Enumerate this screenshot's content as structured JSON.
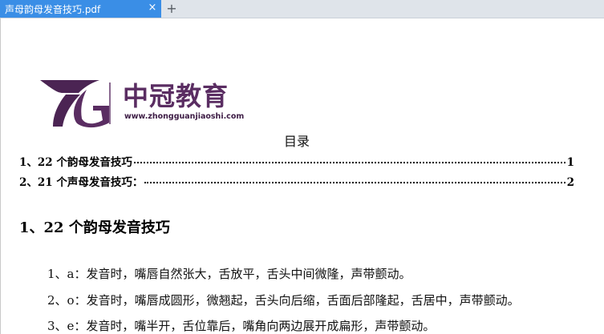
{
  "tab": {
    "title": "声母韵母发音技巧.pdf",
    "close": "×",
    "new_tab": "+"
  },
  "logo": {
    "text": "中冠教育",
    "url": "www.zhongguanjiaoshi.com"
  },
  "toc": {
    "title": "目录",
    "entries": [
      {
        "label": "1、22 个韵母发音技巧",
        "page": "1"
      },
      {
        "label": "2、21 个声母发音技巧：",
        "page": "2"
      }
    ]
  },
  "section": {
    "heading": "1、22 个韵母发音技巧",
    "paragraphs": [
      "1、a：发音时，嘴唇自然张大，舌放平，舌头中间微隆，声带颤动。",
      "2、o：发音时，嘴唇成圆形，微翘起，舌头向后缩，舌面后部隆起，舌居中，声带颤动。",
      "3、e：发音时，嘴半开，舌位靠后，嘴角向两边展开成扁形，声带颤动。"
    ]
  },
  "colors": {
    "tab_active": "#3a8ee6",
    "tabbar": "#dfe4ea",
    "logo_purple": "#5a2d62"
  }
}
